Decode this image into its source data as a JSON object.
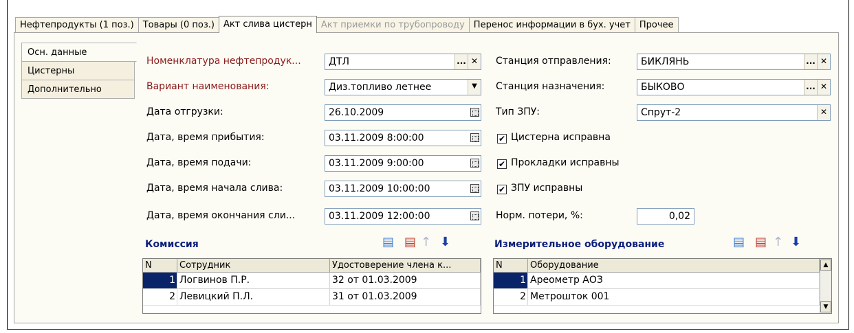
{
  "tabs": [
    {
      "label": "Нефтепродукты (1 поз.)",
      "state": "normal"
    },
    {
      "label": "Товары (0 поз.)",
      "state": "normal"
    },
    {
      "label": "Акт слива цистерн",
      "state": "active"
    },
    {
      "label": "Акт приемки по трубопроводу",
      "state": "disabled"
    },
    {
      "label": "Перенос информации в бух. учет",
      "state": "normal"
    },
    {
      "label": "Прочее",
      "state": "normal"
    }
  ],
  "side_tabs": [
    "Осн. данные",
    "Цистерны",
    "Дополнительно"
  ],
  "left": {
    "nomenclature": {
      "label": "Номенклатура нефтепродук...",
      "value": "ДТЛ"
    },
    "variant": {
      "label": "Вариант наименования:",
      "value": "Диз.топливо летнее"
    },
    "ship_date": {
      "label": "Дата отгрузки:",
      "value": "26.10.2009"
    },
    "arrival": {
      "label": "Дата, время прибытия:",
      "value": "03.11.2009  8:00:00"
    },
    "supply": {
      "label": "Дата, время подачи:",
      "value": "03.11.2009  9:00:00"
    },
    "drain_start": {
      "label": "Дата, время начала слива:",
      "value": "03.11.2009 10:00:00"
    },
    "drain_end": {
      "label": "Дата, время окончания сли...",
      "value": "03.11.2009 12:00:00"
    }
  },
  "right": {
    "from_station": {
      "label": "Станция отправления:",
      "value": "БИКЛЯНЬ"
    },
    "to_station": {
      "label": "Станция назначения:",
      "value": "БЫКОВО"
    },
    "zpu_type": {
      "label": "Тип ЗПУ:",
      "value": "Спрут-2"
    },
    "tank_ok": {
      "label": "Цистерна исправна",
      "checked": true
    },
    "gaskets_ok": {
      "label": "Прокладки исправны",
      "checked": true
    },
    "zpu_ok": {
      "label": "ЗПУ исправны",
      "checked": true
    },
    "norm_loss": {
      "label": "Норм. потери, %:",
      "value": "0,02"
    }
  },
  "commission": {
    "title": "Комиссия",
    "columns": [
      "N",
      "Сотрудник",
      "Удостоверение члена к..."
    ],
    "rows": [
      {
        "n": "1",
        "name": "Логвинов П.Р.",
        "cert": "32 от 01.03.2009",
        "selected": true
      },
      {
        "n": "2",
        "name": "Левицкий П.Л.",
        "cert": "31 от 01.03.2009",
        "selected": false
      }
    ]
  },
  "equipment": {
    "title": "Измерительное оборудование",
    "columns": [
      "N",
      "Оборудование"
    ],
    "rows": [
      {
        "n": "1",
        "name": "Ареометр АОЗ",
        "selected": true
      },
      {
        "n": "2",
        "name": "Метрошток 001",
        "selected": false
      }
    ]
  },
  "icons": {
    "ellipsis": "...",
    "clear": "✕",
    "dropdown": "▼",
    "check": "✔",
    "up": "↑",
    "down": "⬇",
    "scroll_up": "▲",
    "scroll_down": "▼"
  }
}
